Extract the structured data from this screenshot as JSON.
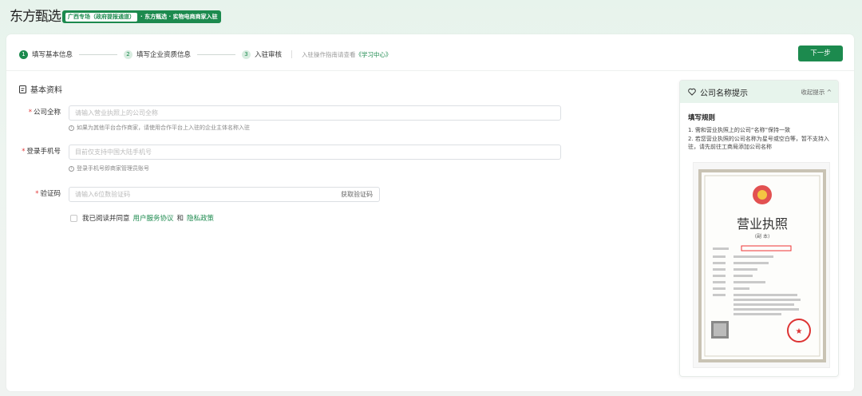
{
  "header": {
    "logo_text": "东方甄选",
    "badge_chip": "广西专场（政府提报通道）",
    "badge_rest": "· 东方甄选 · 实物电商商家入驻"
  },
  "steps": [
    {
      "num": "1",
      "label": "填写基本信息",
      "active": true
    },
    {
      "num": "2",
      "label": "填写企业资质信息",
      "active": false
    },
    {
      "num": "3",
      "label": "入驻审核",
      "active": false
    }
  ],
  "guide": {
    "text": "入驻操作指南请查看",
    "link": "《学习中心》"
  },
  "next_button": "下一步",
  "section_title": "基本资料",
  "form": {
    "company": {
      "label": "公司全称",
      "placeholder": "请输入营业执照上的公司全称",
      "hint": "如果为其他平台合作商家，请使用合作平台上入驻的企业主体名称入驻"
    },
    "phone": {
      "label": "登录手机号",
      "placeholder": "目前仅支持中国大陆手机号",
      "hint": "登录手机号即商家管理员账号"
    },
    "code": {
      "label": "验证码",
      "placeholder": "请输入6位数验证码",
      "suffix": "获取验证码"
    },
    "agreement": {
      "prefix": "我已阅读并同意",
      "link1": "用户服务协议",
      "and": "和",
      "link2": "隐私政策"
    }
  },
  "tip": {
    "title": "公司名称提示",
    "collapse": "收起提示 ^",
    "rules_title": "填写规则",
    "rule1": "1. 需和营业执照上的公司“名称”保持一致",
    "rule2": "2. 若您营业执照的公司名称为星号或空白等，暂不支持入驻，请先前往工商局添加公司名称",
    "license_title": "营业执照",
    "license_sub": "(副 本)"
  },
  "colors": {
    "brand": "#1c8a4e",
    "required": "#e23b3b"
  }
}
